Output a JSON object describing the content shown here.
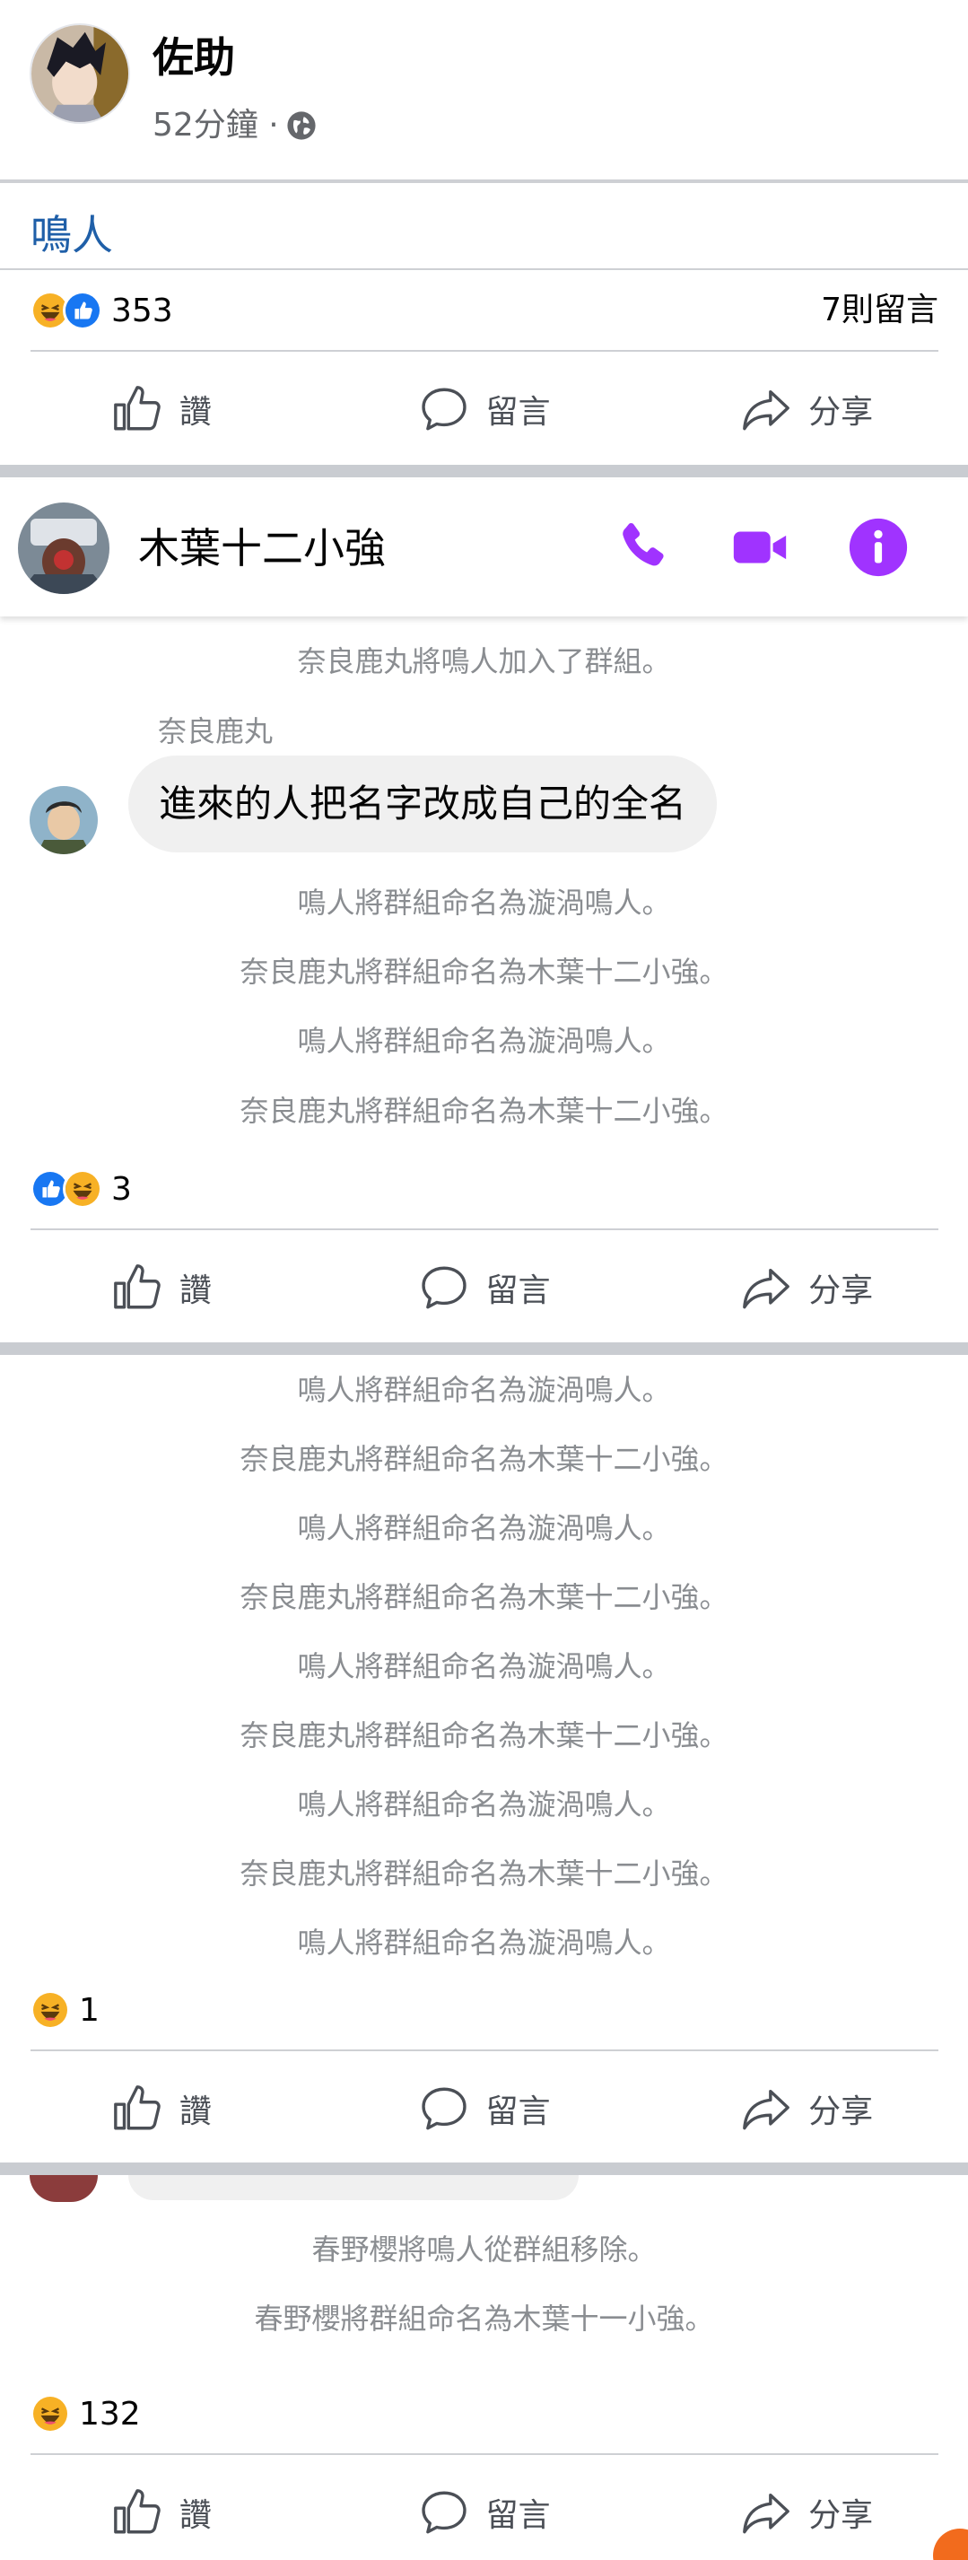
{
  "post": {
    "author": "佐助",
    "time": "52分鐘 ·",
    "privacy_icon": "globe-icon",
    "text": "鳴人"
  },
  "action_labels": {
    "like": "讚",
    "comment": "留言",
    "share": "分享"
  },
  "reaction_blocks": [
    {
      "count": "353",
      "comments": "7則留言",
      "reactions": [
        "haha",
        "like"
      ]
    },
    {
      "count": "3",
      "reactions": [
        "like",
        "haha"
      ]
    },
    {
      "count": "1",
      "reactions": [
        "haha"
      ]
    },
    {
      "count": "132",
      "reactions": [
        "haha"
      ]
    }
  ],
  "chat": {
    "group_name": "木葉十二小強",
    "header_icons": [
      "phone-icon",
      "video-icon",
      "info-icon"
    ],
    "accent_color": "#a033ff",
    "added_notice": "奈良鹿丸將鳴人加入了群組。",
    "sender": "奈良鹿丸",
    "message": "進來的人把名字改成自己的全名",
    "notices_a": [
      "鳴人將群組命名為漩渦鳴人。",
      "奈良鹿丸將群組命名為木葉十二小強。",
      "鳴人將群組命名為漩渦鳴人。",
      "奈良鹿丸將群組命名為木葉十二小強。"
    ],
    "notices_b": [
      "鳴人將群組命名為漩渦鳴人。",
      "奈良鹿丸將群組命名為木葉十二小強。",
      "鳴人將群組命名為漩渦鳴人。",
      "奈良鹿丸將群組命名為木葉十二小強。",
      "鳴人將群組命名為漩渦鳴人。",
      "奈良鹿丸將群組命名為木葉十二小強。",
      "鳴人將群組命名為漩渦鳴人。",
      "奈良鹿丸將群組命名為木葉十二小強。",
      "鳴人將群組命名為漩渦鳴人。"
    ],
    "notices_c": [
      "春野櫻將鳴人從群組移除。",
      "春野櫻將群組命名為木葉十一小強。"
    ]
  },
  "colors": {
    "like_blue": "#1877f2",
    "haha_yellow": "#f7b125",
    "link_blue": "#1f5fa8",
    "separator": "#c9ccd1"
  }
}
